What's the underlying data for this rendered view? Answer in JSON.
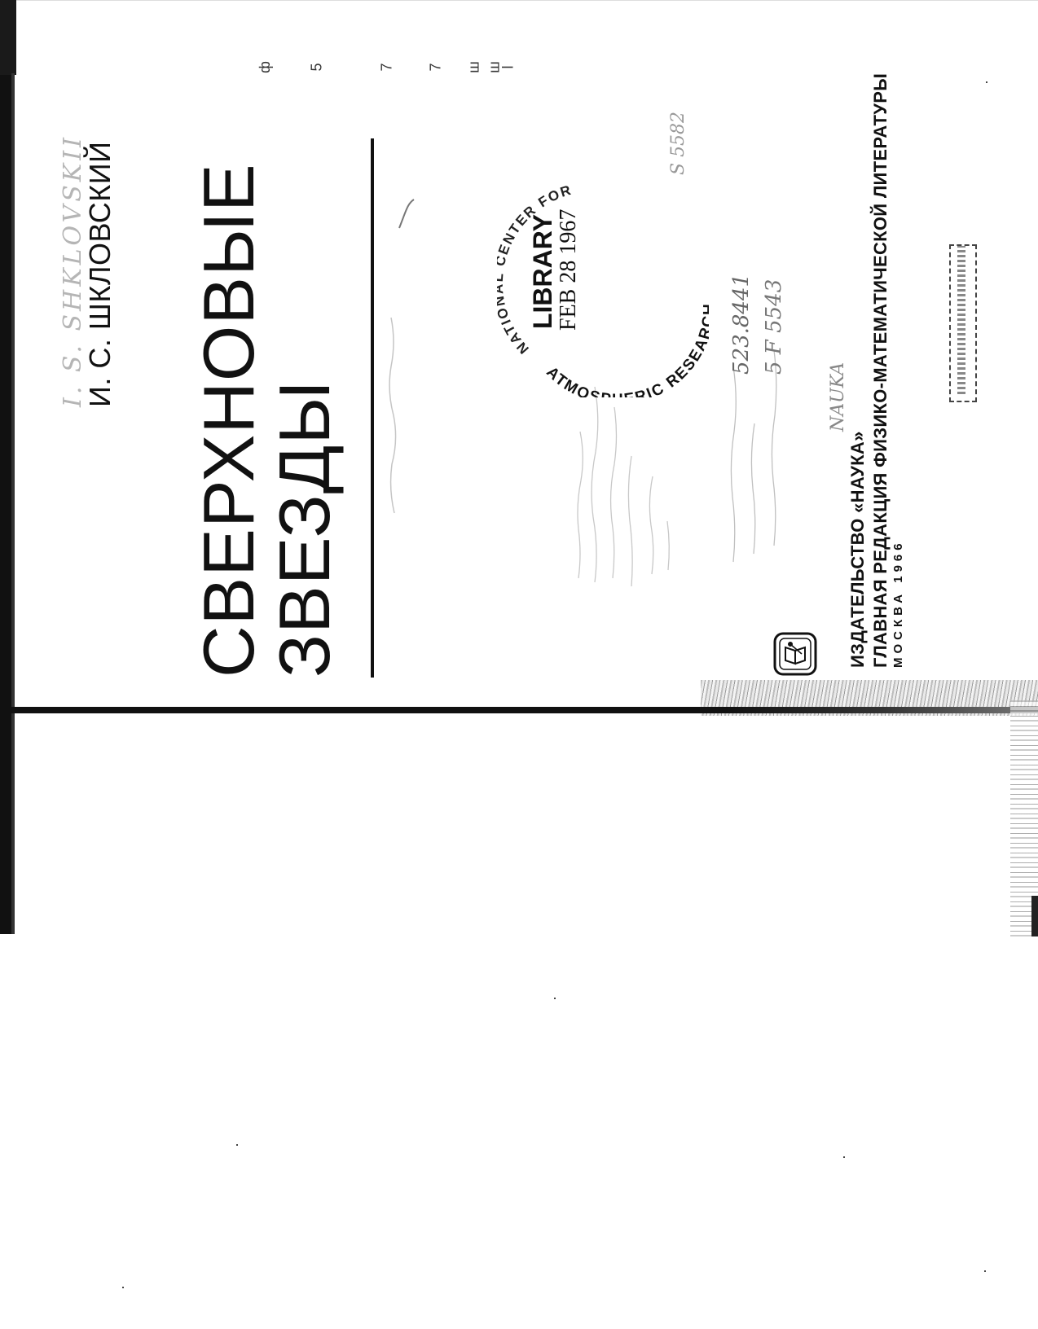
{
  "book": {
    "author_handwritten": "I. S. SHKLOVSKII",
    "author": "И. С. ШКЛОВСКИЙ",
    "title_line1": "СВЕРХНОВЫЕ",
    "title_line2": "ЗВЕЗДЫ",
    "publisher_line1": "ИЗДАТЕЛЬСТВО «НАУКА»",
    "publisher_line2": "ГЛАВНАЯ РЕДАКЦИЯ ФИЗИКО-МАТЕМАТИЧЕСКОЙ ЛИТЕРАТУРЫ",
    "publisher_line3": "МОСКВА 1966"
  },
  "library_stamp": {
    "ring_top": "NATIONAL CENTER FOR",
    "ring_bottom": "ATMOSPHERIC RESEARCH",
    "label": "LIBRARY",
    "date": "FEB 28 1967"
  },
  "handwritten_notes": {
    "call_number_1": "523.8441",
    "call_number_2": "5 F 5543",
    "call_number_3": "S 5582",
    "publisher_note": "NAUKA"
  }
}
